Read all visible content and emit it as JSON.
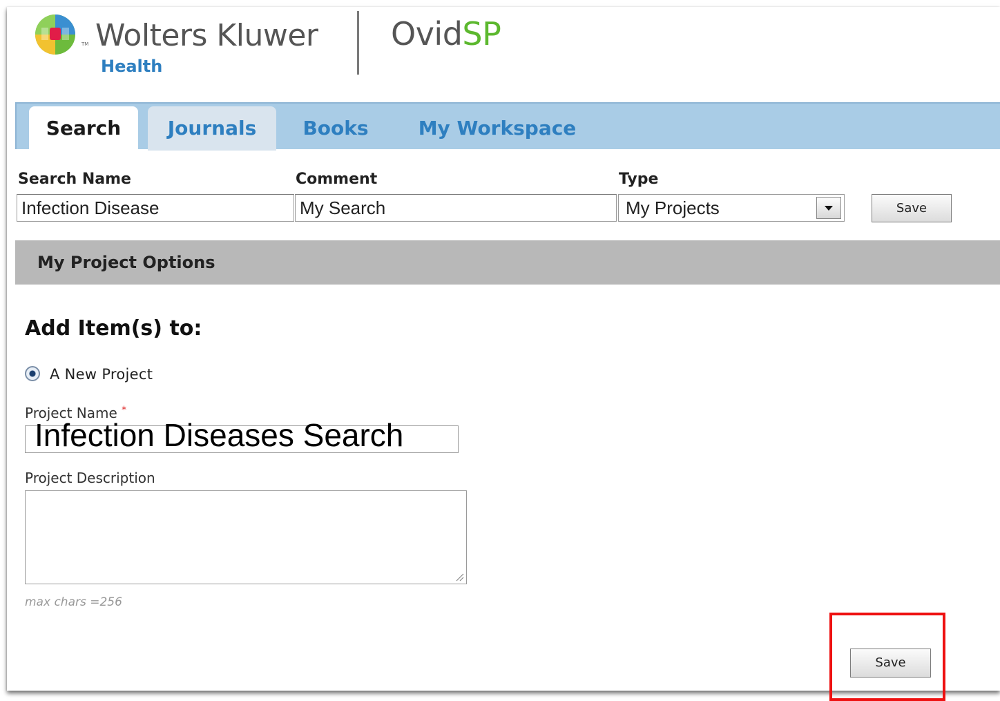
{
  "header": {
    "brand_name": "Wolters Kluwer",
    "brand_tm": "TM",
    "brand_sub": "Health",
    "product_prefix": "Ovid",
    "product_suffix": "SP"
  },
  "tabs": [
    {
      "label": "Search",
      "active": true
    },
    {
      "label": "Journals",
      "active": false
    },
    {
      "label": "Books",
      "active": false
    },
    {
      "label": "My Workspace",
      "active": false
    }
  ],
  "save_search": {
    "search_name_label": "Search Name",
    "search_name_value": "Infection Disease",
    "comment_label": "Comment",
    "comment_value": "My Search",
    "type_label": "Type",
    "type_value": "My Projects",
    "save_label": "Save"
  },
  "options": {
    "title": "My Project Options",
    "add_title": "Add Item(s) to:",
    "radio_label": "A New Project",
    "radio_selected": true,
    "project_name_label": "Project Name",
    "project_name_required": "*",
    "project_name_value": "Infection Diseases Search",
    "project_description_label": "Project Description",
    "project_description_value": "",
    "max_chars_note": "max chars =256",
    "save_label": "Save"
  },
  "colors": {
    "tab_bar": "#a9cce6",
    "tab_link": "#2e7fc0",
    "brand_green": "#5cb82e",
    "highlight": "#ee1111"
  }
}
